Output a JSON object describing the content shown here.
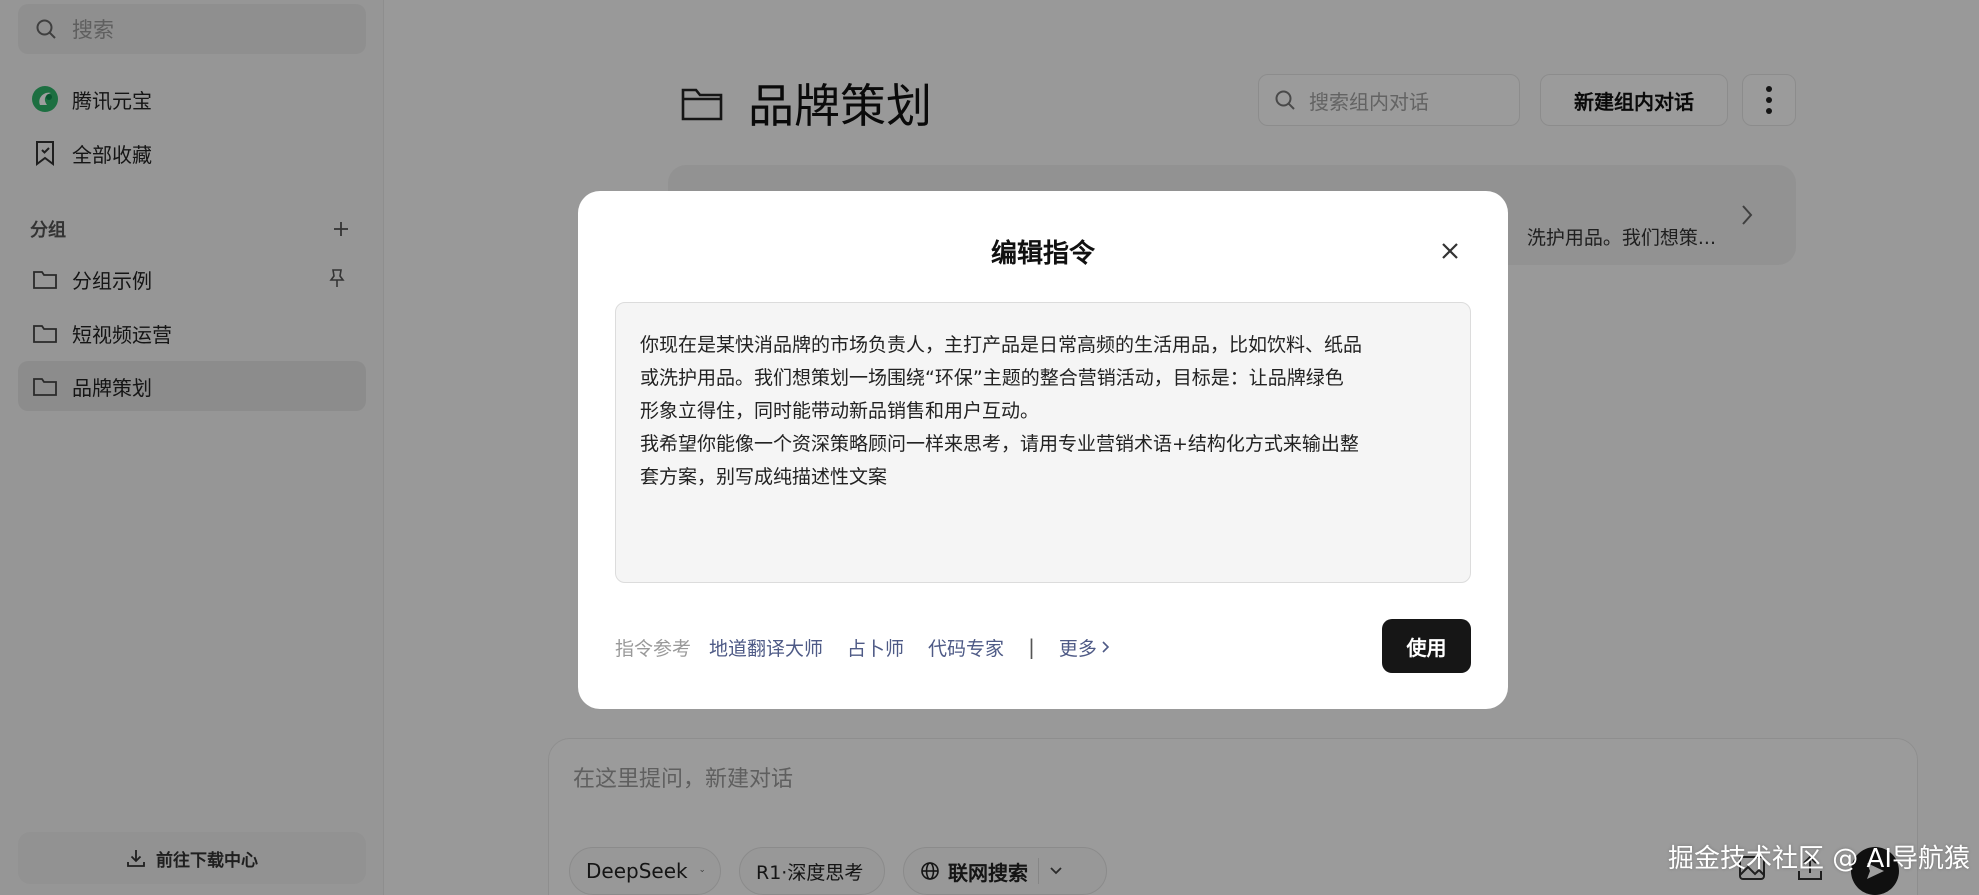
{
  "sidebar": {
    "search_placeholder": "搜索",
    "app_name": "腾讯元宝",
    "favorites": "全部收藏",
    "group_header": "分组",
    "groups": [
      {
        "label": "分组示例"
      },
      {
        "label": "短视频运营"
      },
      {
        "label": "品牌策划"
      }
    ],
    "download": "前往下载中心"
  },
  "main": {
    "title": "品牌策划",
    "search_placeholder": "搜索组内对话",
    "new_chat": "新建组内对话",
    "card_preview": "洗护用品。我们想策..."
  },
  "composer": {
    "placeholder": "在这里提问，新建对话",
    "model": "DeepSeek",
    "r1": "R1·深度思考",
    "web": "联网搜索"
  },
  "modal": {
    "title": "编辑指令",
    "prompt_lines": [
      "你现在是某快消品牌的市场负责人，主打产品是日常高频的生活用品，比如饮料、纸品",
      "或洗护用品。我们想策划一场围绕“环保”主题的整合营销活动，目标是：让品牌绿色",
      "形象立得住，同时能带动新品销售和用户互动。",
      "我希望你能像一个资深策略顾问一样来思考，请用专业营销术语+结构化方式来输出整",
      "套方案，别写成纯描述性文案"
    ],
    "ref_label": "指令参考",
    "refs": [
      "地道翻译大师",
      "占卜师",
      "代码专家"
    ],
    "separator": "|",
    "more": "更多",
    "use_button": "使用"
  },
  "watermark": "掘金技术社区 @ AI导航猿",
  "colors": {
    "overlay": "rgba(0,0,0,0.38)",
    "primary_button": "#161616",
    "link": "#4e5a86",
    "brand_green": "#2fb36a"
  }
}
